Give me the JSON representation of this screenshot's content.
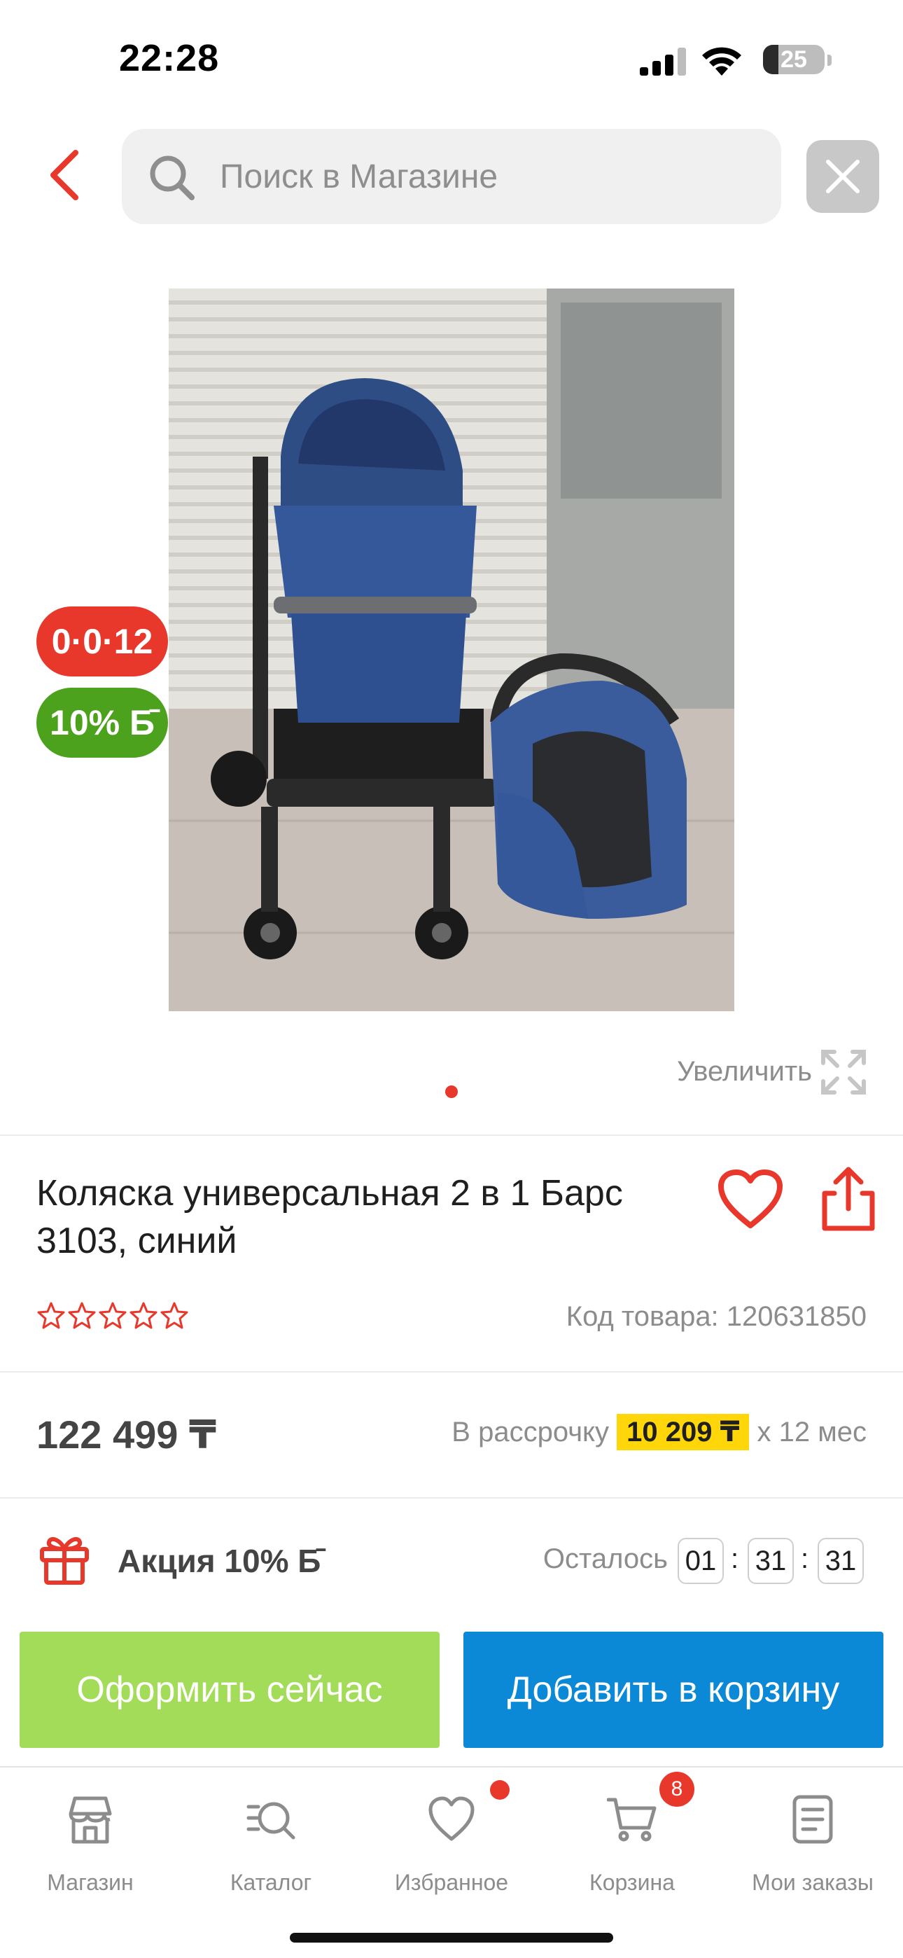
{
  "status_bar": {
    "time": "22:28",
    "battery": "25",
    "battery_level": 0.25
  },
  "header": {
    "back_icon": "chevron-left-icon",
    "search_placeholder": "Поиск в Магазине",
    "search_value": "",
    "close_icon": "close-icon"
  },
  "product": {
    "badge_installment": "0·0·12",
    "badge_bonus": "10% Б̄",
    "zoom_label": "Увеличить",
    "image_count": 1,
    "active_image": 1,
    "title": "Коляска универсальная 2 в 1 Барс 3103, синий",
    "rating": 0,
    "rating_max": 5,
    "sku": "Код товара: 120631850",
    "price": "122 499 ₸",
    "installment_prefix": "В рассрочку",
    "installment_amount": "10 209 ₸",
    "installment_suffix": "х 12 мес",
    "promo_label": "Акция 10% Б̄",
    "countdown_label": "Осталось",
    "countdown": {
      "hours": "01",
      "minutes": "31",
      "seconds": "31"
    }
  },
  "actions": {
    "buy_now": "Оформить сейчас",
    "add_to_cart": "Добавить в корзину"
  },
  "tab_bar": {
    "items": [
      {
        "label": "Магазин",
        "icon": "store-icon"
      },
      {
        "label": "Каталог",
        "icon": "catalog-search-icon"
      },
      {
        "label": "Избранное",
        "icon": "heart-icon"
      },
      {
        "label": "Корзина",
        "icon": "cart-icon"
      },
      {
        "label": "Мои заказы",
        "icon": "orders-icon"
      }
    ],
    "cart_count": "8"
  },
  "colors": {
    "accent_red": "#e8382c",
    "bonus_green": "#4ca21d",
    "buy_now_green": "#a3dc58",
    "cart_blue": "#0b88d6",
    "installment_yellow": "#ffd60a"
  }
}
